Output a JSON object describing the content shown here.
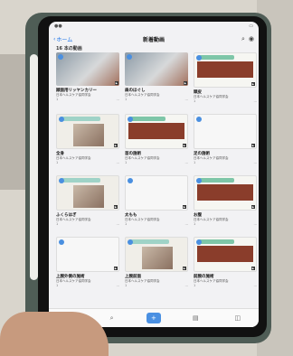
{
  "header": {
    "back_label": "ホーム",
    "title": "新着動画"
  },
  "section_title": "16 本の動画",
  "cards": [
    {
      "title": "顔面用リッヤンカリー",
      "subtitle": "日本ヘルスケア協同学会",
      "views": "1",
      "thumb": "photo"
    },
    {
      "title": "肩のほぐし",
      "subtitle": "日本ヘルスケア協同学会",
      "views": "1",
      "thumb": "photo"
    },
    {
      "title": "頭皮",
      "subtitle": "日本ヘルスケア協同学会",
      "views": "1",
      "thumb": "slide"
    },
    {
      "title": "全身",
      "subtitle": "日本ヘルスケア協同学会",
      "views": "1",
      "thumb": "mixed"
    },
    {
      "title": "首の施術",
      "subtitle": "日本ヘルスケア協同学会",
      "views": "1",
      "thumb": "slide"
    },
    {
      "title": "足の施術",
      "subtitle": "日本ヘルスケア協同学会",
      "views": "1",
      "thumb": "white"
    },
    {
      "title": "ふくらはぎ",
      "subtitle": "日本ヘルスケア協同学会",
      "views": "1",
      "thumb": "mixed"
    },
    {
      "title": "太もも",
      "subtitle": "日本ヘルスケア協同学会",
      "views": "1",
      "thumb": "white"
    },
    {
      "title": "お腹",
      "subtitle": "日本ヘルスケア協同学会",
      "views": "1",
      "thumb": "slide"
    },
    {
      "title": "上腕外側の施術",
      "subtitle": "日本ヘルスケア協同学会",
      "views": "1",
      "thumb": "white"
    },
    {
      "title": "上腕前面",
      "subtitle": "日本ヘルスケア協同学会",
      "views": "1",
      "thumb": "mixed"
    },
    {
      "title": "前腕の施術",
      "subtitle": "日本ヘルスケア協同学会",
      "views": "1",
      "thumb": "slide"
    }
  ],
  "tabs": [
    {
      "name": "home-icon",
      "glyph": "⌂"
    },
    {
      "name": "search-icon",
      "glyph": "⌕"
    },
    {
      "name": "add-icon",
      "glyph": "+"
    },
    {
      "name": "library-icon",
      "glyph": "▤"
    },
    {
      "name": "account-icon",
      "glyph": "◫"
    }
  ],
  "active_tab_index": 2,
  "colors": {
    "accent": "#4a90e2",
    "slide_band": "#8a3d2b",
    "slide_header": "#7ec6a8"
  }
}
